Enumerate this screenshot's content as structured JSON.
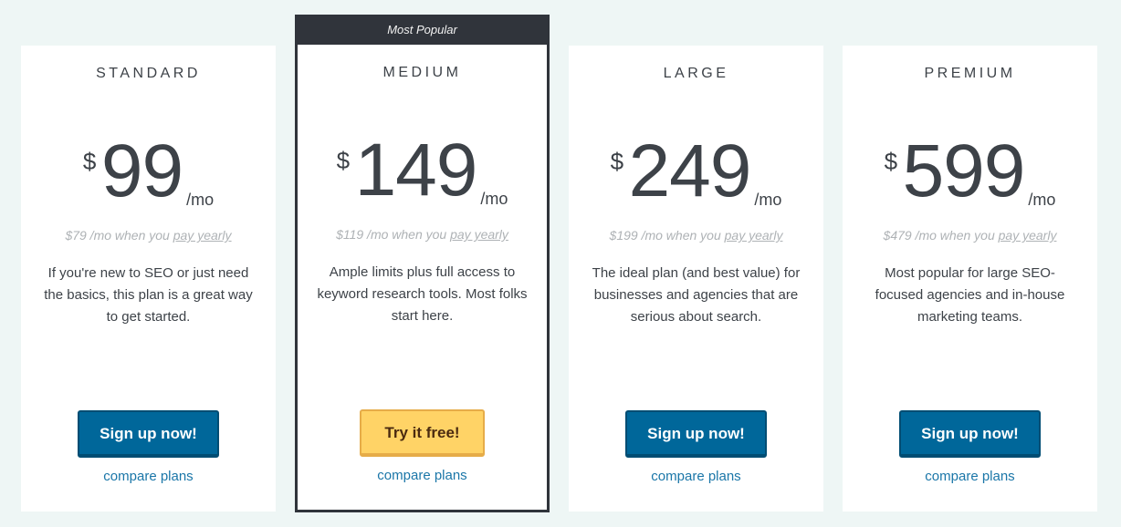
{
  "plans": [
    {
      "name": "STANDARD",
      "currency": "$",
      "price": "99",
      "period": "/mo",
      "yearly_prefix": "$79 /mo when you ",
      "yearly_link": "pay yearly",
      "description": "If you're new to SEO or just need the basics, this plan is a great way to get started.",
      "button": "Sign up now!",
      "compare": "compare plans"
    },
    {
      "ribbon": "Most Popular",
      "name": "MEDIUM",
      "currency": "$",
      "price": "149",
      "period": "/mo",
      "yearly_prefix": "$119 /mo when you ",
      "yearly_link": "pay yearly",
      "description": "Ample limits plus full access to keyword research tools. Most folks start here.",
      "button": "Try it free!",
      "compare": "compare plans"
    },
    {
      "name": "LARGE",
      "currency": "$",
      "price": "249",
      "period": "/mo",
      "yearly_prefix": "$199 /mo when you ",
      "yearly_link": "pay yearly",
      "description": "The ideal plan (and best value) for businesses and agencies that are serious about search.",
      "button": "Sign up now!",
      "compare": "compare plans"
    },
    {
      "name": "PREMIUM",
      "currency": "$",
      "price": "599",
      "period": "/mo",
      "yearly_prefix": "$479 /mo when you ",
      "yearly_link": "pay yearly",
      "description": "Most popular for large SEO-focused agencies and in-house marketing teams.",
      "button": "Sign up now!",
      "compare": "compare plans"
    }
  ],
  "colors": {
    "background": "#eef6f5",
    "featured_border": "#30343b",
    "primary_button": "#00679a",
    "trial_button": "#ffd366",
    "link": "#1a76a8"
  }
}
